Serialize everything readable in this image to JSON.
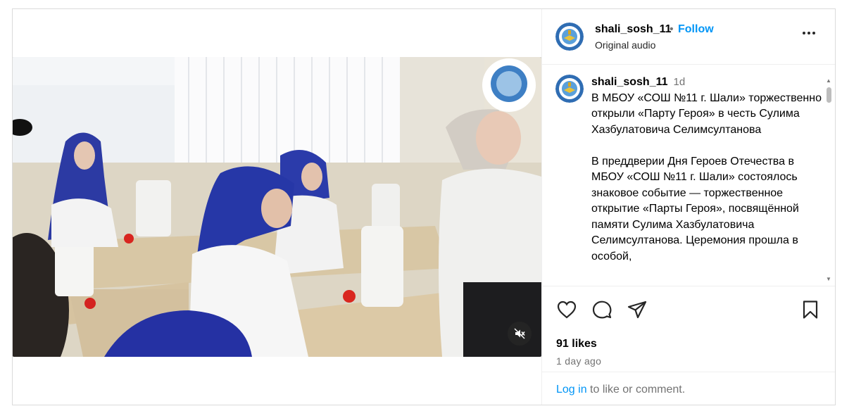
{
  "post": {
    "username": "shali_sosh_11",
    "follow_label": "Follow",
    "separator": "•",
    "audio_label": "Original audio",
    "more_icon": "more-horizontal-icon"
  },
  "caption": {
    "username": "shali_sosh_11",
    "time": "1d",
    "text": "В МБОУ «СОШ №11 г. Шали» торжественно открыли «Парту Героя» в честь Сулима Хазбулатовича Селимсултанова\n\nВ преддверии Дня Героев Отечества в МБОУ «СОШ №11 г. Шали» состоялось знаковое событие — торжественное открытие «Парты Героя», посвящённой памяти Сулима Хазбулатовича Селимсултанова. Церемония прошла в особой,"
  },
  "actions": {
    "likes": "91 likes",
    "posted": "1 day ago",
    "icons": [
      "heart-icon",
      "comment-icon",
      "share-icon",
      "bookmark-icon"
    ]
  },
  "login": {
    "link_label": "Log in",
    "rest": " to like or comment."
  },
  "media": {
    "muted": true,
    "mute_icon": "muted-speaker-icon"
  },
  "colors": {
    "accent": "#0095f6",
    "secondary_text": "#737373",
    "border": "#dbdbdb"
  }
}
